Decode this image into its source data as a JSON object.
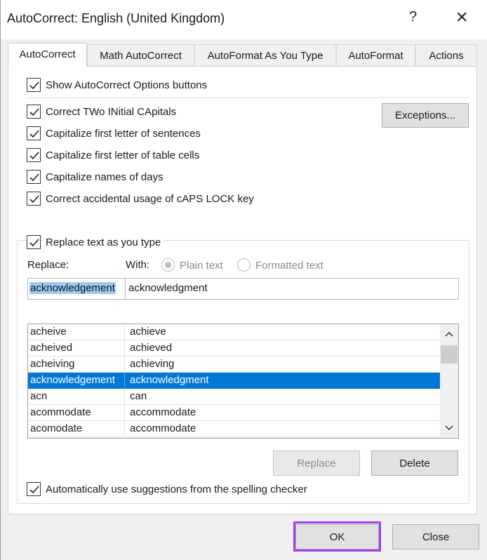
{
  "window": {
    "title": "AutoCorrect: English (United Kingdom)",
    "help_glyph": "?",
    "close_glyph": "✕"
  },
  "tabs": [
    {
      "label": "AutoCorrect",
      "active": true
    },
    {
      "label": "Math AutoCorrect",
      "active": false
    },
    {
      "label": "AutoFormat As You Type",
      "active": false
    },
    {
      "label": "AutoFormat",
      "active": false
    },
    {
      "label": "Actions",
      "active": false
    }
  ],
  "options": {
    "show_buttons": {
      "label": "Show AutoCorrect Options buttons",
      "checked": true
    },
    "two_initial": {
      "label": "Correct TWo INitial CApitals",
      "checked": true
    },
    "first_letter_sentences": {
      "label": "Capitalize first letter of sentences",
      "checked": true
    },
    "first_letter_table": {
      "label": "Capitalize first letter of table cells",
      "checked": true
    },
    "names_of_days": {
      "label": "Capitalize names of days",
      "checked": true
    },
    "caps_lock": {
      "label": "Correct accidental usage of cAPS LOCK key",
      "checked": true
    },
    "replace_as_type": {
      "label": "Replace text as you type",
      "checked": true
    },
    "spelling_suggestions": {
      "label": "Automatically use suggestions from the spelling checker",
      "checked": true
    }
  },
  "exceptions_button": "Exceptions...",
  "replace_section": {
    "replace_label": "Replace:",
    "with_label": "With:",
    "plain_text_label": "Plain text",
    "formatted_text_label": "Formatted text",
    "replace_value": "acknowledgement",
    "with_value": "acknowledgment"
  },
  "entries": [
    {
      "from": "acheive",
      "to": "achieve",
      "selected": false
    },
    {
      "from": "acheived",
      "to": "achieved",
      "selected": false
    },
    {
      "from": "acheiving",
      "to": "achieving",
      "selected": false
    },
    {
      "from": "acknowledgement",
      "to": "acknowledgment",
      "selected": true
    },
    {
      "from": "acn",
      "to": "can",
      "selected": false
    },
    {
      "from": "acommodate",
      "to": "accommodate",
      "selected": false
    },
    {
      "from": "acomodate",
      "to": "accommodate",
      "selected": false
    }
  ],
  "buttons": {
    "replace": "Replace",
    "delete": "Delete",
    "ok": "OK",
    "close": "Close"
  },
  "colors": {
    "selection": "#0078d7",
    "highlight_frame": "#a040f0"
  }
}
